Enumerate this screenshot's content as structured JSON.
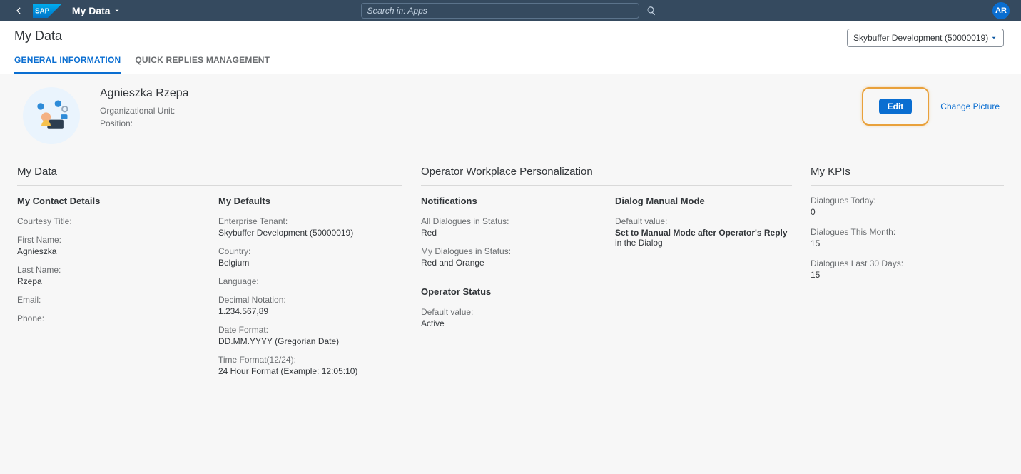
{
  "header": {
    "app_title": "My Data",
    "search_placeholder": "Search in: Apps",
    "user_initials": "AR"
  },
  "page": {
    "title": "My Data",
    "tenant_selected": "Skybuffer Development (50000019)",
    "tabs": [
      {
        "key": "general",
        "label": "GENERAL INFORMATION",
        "active": true
      },
      {
        "key": "quick",
        "label": "QUICK REPLIES MANAGEMENT",
        "active": false
      }
    ],
    "actions": {
      "edit_label": "Edit",
      "change_picture_label": "Change Picture"
    }
  },
  "identity": {
    "name": "Agnieszka Rzepa",
    "org_unit_label": "Organizational Unit:",
    "org_unit_value": "",
    "position_label": "Position:",
    "position_value": ""
  },
  "my_data": {
    "section_title": "My Data",
    "contact": {
      "title": "My Contact Details",
      "fields": {
        "courtesy_title_label": "Courtesy Title:",
        "courtesy_title_value": "",
        "first_name_label": "First Name:",
        "first_name_value": "Agnieszka",
        "last_name_label": "Last Name:",
        "last_name_value": "Rzepa",
        "email_label": "Email:",
        "email_value": "",
        "phone_label": "Phone:",
        "phone_value": ""
      }
    },
    "defaults": {
      "title": "My Defaults",
      "fields": {
        "enterprise_tenant_label": "Enterprise Tenant:",
        "enterprise_tenant_value": "Skybuffer Development (50000019)",
        "country_label": "Country:",
        "country_value": "Belgium",
        "language_label": "Language:",
        "language_value": "",
        "decimal_label": "Decimal Notation:",
        "decimal_value": "1.234.567,89",
        "date_label": "Date Format:",
        "date_value": "DD.MM.YYYY (Gregorian Date)",
        "time_label": "Time Format(12/24):",
        "time_value": "24 Hour Format (Example: 12:05:10)"
      }
    }
  },
  "personalization": {
    "section_title": "Operator Workplace Personalization",
    "notifications": {
      "title": "Notifications",
      "all_dialogues_label": "All Dialogues in Status:",
      "all_dialogues_value": "Red",
      "my_dialogues_label": "My Dialogues in Status:",
      "my_dialogues_value": "Red and Orange"
    },
    "dialog_manual": {
      "title": "Dialog Manual Mode",
      "default_label": "Default value:",
      "default_value_bold": "Set to Manual Mode after Operator's Reply",
      "default_value_rest": " in the Dialog"
    },
    "operator_status": {
      "title": "Operator Status",
      "default_label": "Default value:",
      "default_value": "Active"
    }
  },
  "kpis": {
    "section_title": "My KPIs",
    "items": [
      {
        "label": "Dialogues Today:",
        "value": "0"
      },
      {
        "label": "Dialogues This Month:",
        "value": "15"
      },
      {
        "label": "Dialogues Last 30 Days:",
        "value": "15"
      }
    ]
  }
}
